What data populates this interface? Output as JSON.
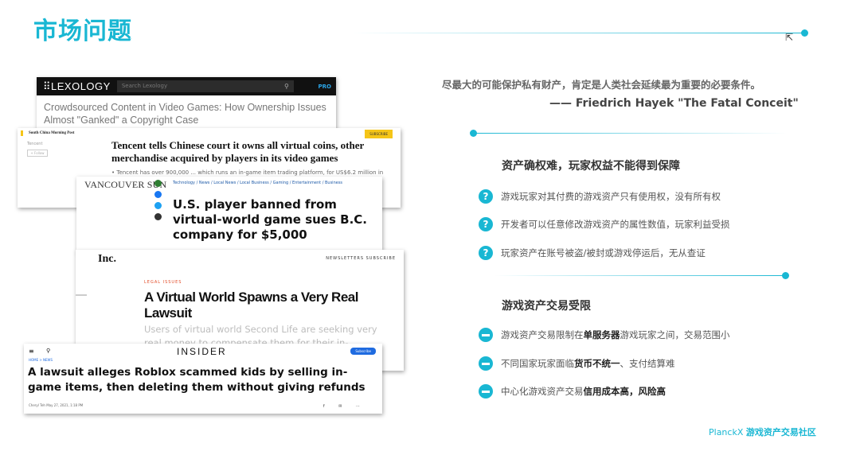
{
  "slide": {
    "title": "市场问题",
    "cursor_glyph": "⇱",
    "accent_color": "#19b7d3"
  },
  "clippings": {
    "lexology": {
      "logo": "⠿LEXOLOGY",
      "search_placeholder": "Search Lexology",
      "search_icon": "⚲",
      "pro": "PRO",
      "headline": "Crowdsourced Content in Video Games: How Ownership Issues Almost \"Ganked\" a Copyright Case"
    },
    "scmp": {
      "logo": "South China Morning Post",
      "tag": "Tencent",
      "pill": "+ Follow",
      "subscribe": "SUBSCRIBE",
      "headline": "Tencent tells Chinese court it owns all virtual coins, other merchandise acquired by players in its video games",
      "summary": "• Tencent has over 900,000 ... which runs an in-game item trading platform, for US$6.2 million in"
    },
    "vancouver_sun": {
      "logo": "VANCOUVER SUN",
      "categories": "Technology / News / Local News / Local Business / Gaming / Entertainment / Business",
      "headline": "U.S. player banned from virtual-world game sues B.C. company for $5,000"
    },
    "inc": {
      "logo": "Inc.",
      "nav": "NEWSLETTERS   SUBSCRIBE",
      "label": "LEGAL ISSUES",
      "headline": "A Virtual World Spawns a Very Real Lawsuit",
      "subhead": "Users of virtual world Second Life are seeking very real money to compensate them for their in-"
    },
    "insider": {
      "menu": "≡",
      "search": "⚲",
      "logo": "INSIDER",
      "subscribe": "Subscribe",
      "crumb": "HOME  >  NEWS",
      "headline": "A lawsuit alleges Roblox scammed kids by selling in-game items, then deleting them without giving refunds",
      "meta": "Cheryl Teh   May 27, 2021, 1:18 PM",
      "social": "f ✉ ⋯"
    }
  },
  "quote": {
    "text": "尽最大的可能保护私有财产，肯定是人类社会延续最为重要的必要条件。",
    "author": "—— Friedrich Hayek \"The Fatal Conceit\""
  },
  "section1": {
    "title": "资产确权难，玩家权益不能得到保障",
    "icon": "?",
    "items": [
      "游戏玩家对其付费的游戏资产只有使用权，没有所有权",
      "开发者可以任意修改游戏资产的属性数值，玩家利益受损",
      "玩家资产在账号被盗/被封或游戏停运后，无从查证"
    ]
  },
  "section2": {
    "title": "游戏资产交易受限",
    "items": [
      {
        "pre": "游戏资产交易限制在",
        "bold": "单服务器",
        "post": "游戏玩家之间，交易范围小"
      },
      {
        "pre": "不同国家玩家面临",
        "bold": "货币不统一",
        "post": "、支付结算难"
      },
      {
        "pre": "中心化游戏资产交易",
        "bold": "信用成本高，风险高",
        "post": ""
      }
    ]
  },
  "footer": {
    "brand": "PlanckX",
    "community": "游戏资产交易社区"
  }
}
